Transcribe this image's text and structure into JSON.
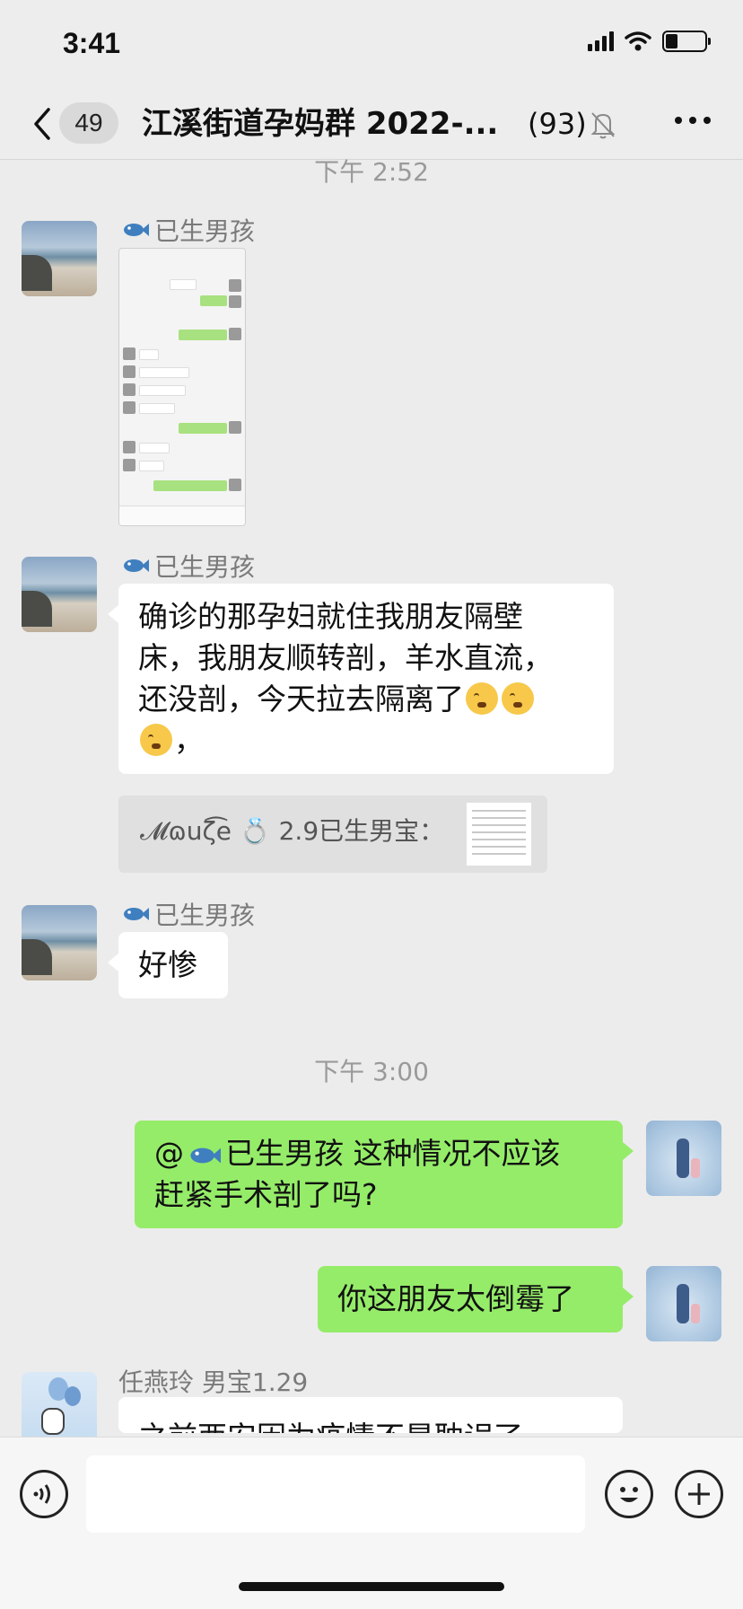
{
  "status_bar": {
    "time": "3:41",
    "battery_level": 0.3
  },
  "nav": {
    "unread_count": "49",
    "title": "江溪街道孕妈群 2022-...",
    "member_count": "(93)",
    "icons": [
      "back-arrow-icon",
      "mute-bell-icon",
      "more-icon"
    ]
  },
  "messages": [
    {
      "type": "time",
      "text": "下午 2:52"
    },
    {
      "type": "image",
      "sender": "已生男孩",
      "direction": "in"
    },
    {
      "type": "text",
      "sender": "已生男孩",
      "direction": "in",
      "text_line1": "确诊的那孕妇就住我朋友隔壁",
      "text_line2": "床，我朋友顺转剖，羊水直流，",
      "text_line3": "还没剖，今天拉去隔离了",
      "text_line4_tail": "，",
      "quote": "𝓜ɷuζ͡e 💍 2.9已生男宝："
    },
    {
      "type": "text",
      "sender": "已生男孩",
      "direction": "in",
      "text": "好惨"
    },
    {
      "type": "time",
      "text": "下午 3:00"
    },
    {
      "type": "text",
      "direction": "out",
      "mention": "@",
      "mention_name": "已生男孩",
      "text_line1_rest": " 这种情况不应该",
      "text_line2": "赶紧手术剖了吗?"
    },
    {
      "type": "text",
      "direction": "out",
      "text": "你这朋友太倒霉了"
    },
    {
      "type": "text",
      "sender": "任燕玲 男宝1.29",
      "direction": "in",
      "text": "之前西安因为疫情不是耽误了一"
    }
  ],
  "input_bar": {
    "placeholder": "",
    "icons": [
      "voice-icon",
      "emoji-icon",
      "plus-icon"
    ]
  }
}
